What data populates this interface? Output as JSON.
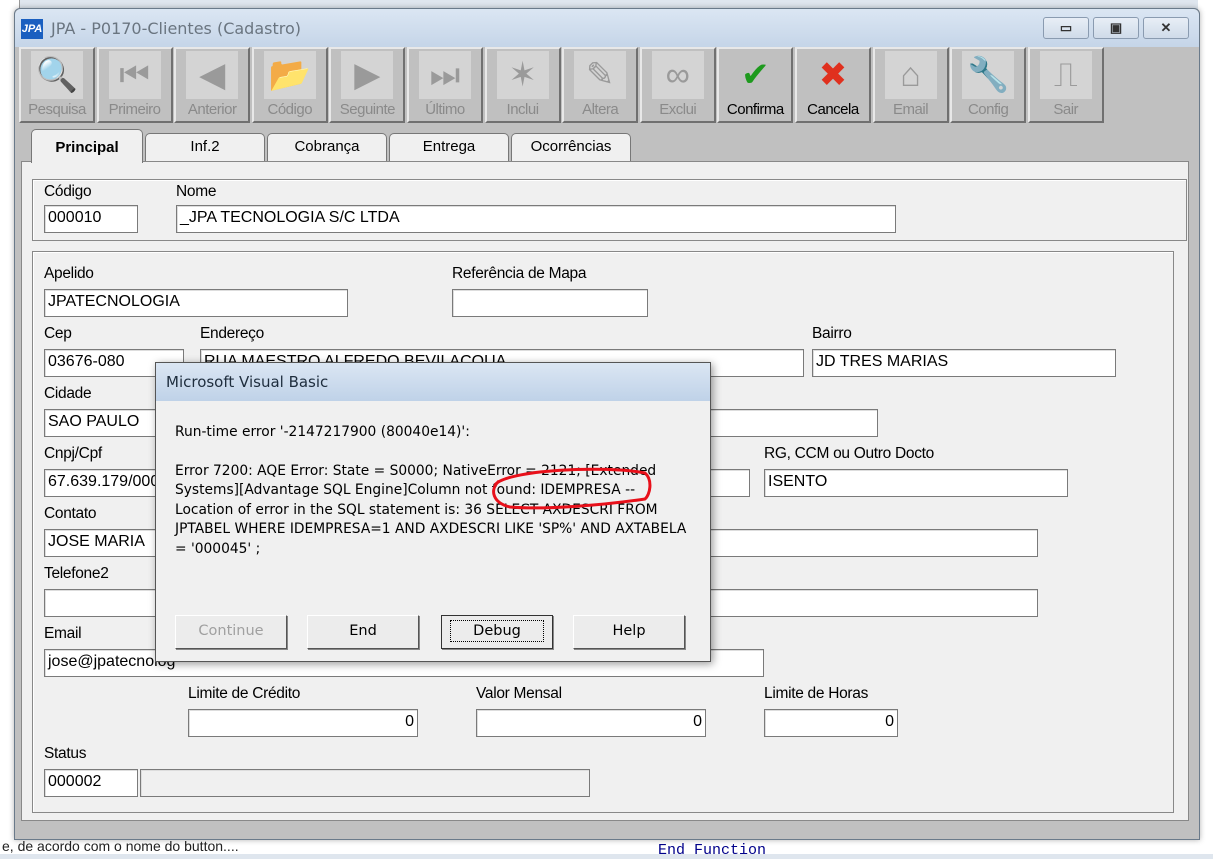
{
  "background": {
    "bottom_text": "e, de acordo com o nome do button....",
    "code_text": "End Function"
  },
  "window": {
    "logo": "JPA",
    "title": "JPA - P0170-Clientes (Cadastro)",
    "minimize": "▭",
    "maximize": "▣",
    "close": "✕"
  },
  "toolbar": [
    {
      "label": "Pesquisa",
      "icon": "magnifier-icon",
      "glyph": "🔍",
      "enabled": false
    },
    {
      "label": "Primeiro",
      "icon": "first-icon",
      "glyph": "⏮",
      "enabled": false
    },
    {
      "label": "Anterior",
      "icon": "previous-icon",
      "glyph": "◀",
      "enabled": false
    },
    {
      "label": "Código",
      "icon": "folder-icon",
      "glyph": "📂",
      "enabled": false
    },
    {
      "label": "Seguinte",
      "icon": "next-icon",
      "glyph": "▶",
      "enabled": false
    },
    {
      "label": "Último",
      "icon": "last-icon",
      "glyph": "⏭",
      "enabled": false
    },
    {
      "label": "Inclui",
      "icon": "star-icon",
      "glyph": "✶",
      "enabled": false
    },
    {
      "label": "Altera",
      "icon": "pencil-icon",
      "glyph": "✎",
      "enabled": false
    },
    {
      "label": "Exclui",
      "icon": "binoculars-icon",
      "glyph": "∞",
      "enabled": false
    },
    {
      "label": "Confirma",
      "icon": "check-icon",
      "glyph": "✔",
      "enabled": true,
      "color": "#1e9a1e"
    },
    {
      "label": "Cancela",
      "icon": "x-icon",
      "glyph": "✖",
      "enabled": true,
      "color": "#e0301e"
    },
    {
      "label": "Email",
      "icon": "envelope-icon",
      "glyph": "⌂",
      "enabled": false
    },
    {
      "label": "Config",
      "icon": "wrench-icon",
      "glyph": "🔧",
      "enabled": false
    },
    {
      "label": "Sair",
      "icon": "exit-door-icon",
      "glyph": "⎍",
      "enabled": false
    }
  ],
  "tabs": [
    "Principal",
    "Inf.2",
    "Cobrança",
    "Entrega",
    "Ocorrências"
  ],
  "form": {
    "codigo_label": "Código",
    "codigo": "000010",
    "nome_label": "Nome",
    "nome": "_JPA TECNOLOGIA S/C LTDA",
    "apelido_label": "Apelido",
    "apelido": "JPATECNOLOGIA",
    "ref_mapa_label": "Referência de Mapa",
    "ref_mapa": "",
    "cep_label": "Cep",
    "cep": "03676-080",
    "endereco_label": "Endereço",
    "endereco": "RUA MAESTRO ALFREDO BEVILACQUA",
    "bairro_label": "Bairro",
    "bairro": "JD TRES MARIAS",
    "cidade_label": "Cidade",
    "cidade": "SAO PAULO",
    "cnpj_label": "Cnpj/Cpf",
    "cnpj": "67.639.179/000",
    "rg_label": "RG, CCM ou Outro Docto",
    "rg": "ISENTO",
    "contato_label": "Contato",
    "contato": "JOSE MARIA",
    "telefone2_label": "Telefone2",
    "telefone2": "",
    "email_label": "Email",
    "email": "jose@jpatecnolog",
    "limite_credito_label": "Limite de Crédito",
    "limite_credito": "0",
    "valor_mensal_label": "Valor Mensal",
    "valor_mensal": "0",
    "limite_horas_label": "Limite de Horas",
    "limite_horas": "0",
    "status_label": "Status",
    "status": "000002",
    "status_desc": ""
  },
  "dialog": {
    "title": "Microsoft Visual Basic",
    "line1": "Run-time error '-2147217900 (80040e14)':",
    "line2": "Error 7200:  AQE Error:  State = S0000;   NativeError = 2121; [Extended Systems][Advantage SQL Engine]Column not found: IDEMPRESA -- Location of error in the SQL statement is: 36   SELECT AXDESCRI FROM JPTABEL WHERE IDEMPRESA=1 AND AXDESCRI LIKE 'SP%' AND AXTABELA = '000045' ;",
    "continue": "Continue",
    "end": "End",
    "debug": "Debug",
    "help": "Help",
    "annotation_color": "#e8101a"
  }
}
